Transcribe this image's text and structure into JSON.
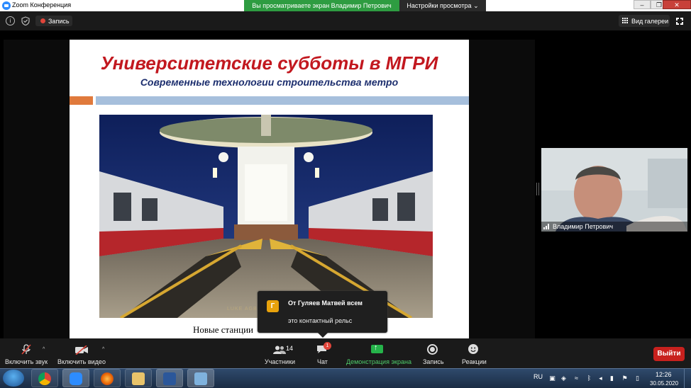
{
  "window": {
    "title": "Zoom Конференция",
    "minimize": "–",
    "restore": "❐",
    "close": "✕"
  },
  "share_banner": {
    "text": "Вы просматриваете экран Владимир Петрович",
    "view_settings": "Настройки просмотра"
  },
  "topbar": {
    "record_label": "Запись",
    "gallery_label": "Вид галереи"
  },
  "slide": {
    "title": "Университетские субботы в МГРИ",
    "subtitle": "Современные технологии строительства метро",
    "caption": "Новые станции",
    "watermark": "LUKE AGBAIMONI"
  },
  "video": {
    "participant_name": "Владимир Петрович"
  },
  "chat_popup": {
    "avatar_letter": "Г",
    "from": "От Гуляев Матвей всем",
    "message": "это контактный рельс"
  },
  "toolbar": {
    "unmute_label": "Включить звук",
    "start_video_label": "Включить видео",
    "participants_label": "Участники",
    "participants_count": "14",
    "chat_label": "Чат",
    "chat_badge": "1",
    "share_label": "Демонстрация экрана",
    "record_label": "Запись",
    "reactions_label": "Реакции",
    "exit_label": "Выйти",
    "caret": "^"
  },
  "taskbar": {
    "language": "RU",
    "time": "12:26",
    "date": "30.05.2020"
  },
  "colors": {
    "accent_green": "#2e9c41",
    "slide_title_red": "#c2181f",
    "slide_subtitle_blue": "#1c2e6e",
    "exit_red": "#c8211e",
    "chat_avatar": "#e8a20c"
  }
}
